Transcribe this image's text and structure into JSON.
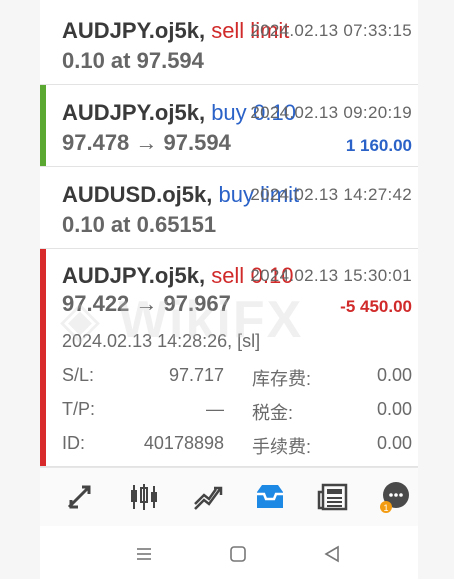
{
  "trades": [
    {
      "symbol": "AUDJPY.oj5k",
      "side_label": "sell limit",
      "side_type": "sell",
      "volume": "",
      "time": "2024.02.13 07:33:15",
      "detail": "0.10 at 97.594",
      "profit": "",
      "accent": ""
    },
    {
      "symbol": "AUDJPY.oj5k",
      "side_label": "buy",
      "side_type": "buy",
      "volume": "0.10",
      "time": "2024.02.13 09:20:19",
      "detail": "97.478 → 97.594",
      "profit": "1 160.00",
      "accent": "#5aa832"
    },
    {
      "symbol": "AUDUSD.oj5k",
      "side_label": "buy limit",
      "side_type": "buy",
      "volume": "",
      "time": "2024.02.13 14:27:42",
      "detail": "0.10 at 0.65151",
      "profit": "",
      "accent": ""
    },
    {
      "symbol": "AUDJPY.oj5k",
      "side_label": "sell",
      "side_type": "sell",
      "volume": "0.10",
      "time": "2024.02.13 15:30:01",
      "detail": "97.422 → 97.967",
      "profit": "-5 450.00",
      "accent": "#d82a2a"
    }
  ],
  "expanded": {
    "open_time": "2024.02.13 14:28:26, [sl]",
    "sl_label": "S/L:",
    "sl_value": "97.717",
    "swap_label": "库存费:",
    "swap_value": "0.00",
    "tp_label": "T/P:",
    "tp_value": "—",
    "taxes_label": "税金:",
    "taxes_value": "0.00",
    "id_label": "ID:",
    "id_value": "40178898",
    "commission_label": "手续费:",
    "commission_value": "0.00"
  },
  "toolbar": {
    "items": [
      "quotes-icon",
      "chart-icon",
      "trade-icon",
      "history-icon",
      "news-icon",
      "chat-icon"
    ],
    "active": "history-icon",
    "chat_badge": "1"
  },
  "colors": {
    "accent_blue": "#1e88e5",
    "buy": "#2a62c8",
    "sell": "#d12a2a",
    "win": "#5aa832"
  }
}
